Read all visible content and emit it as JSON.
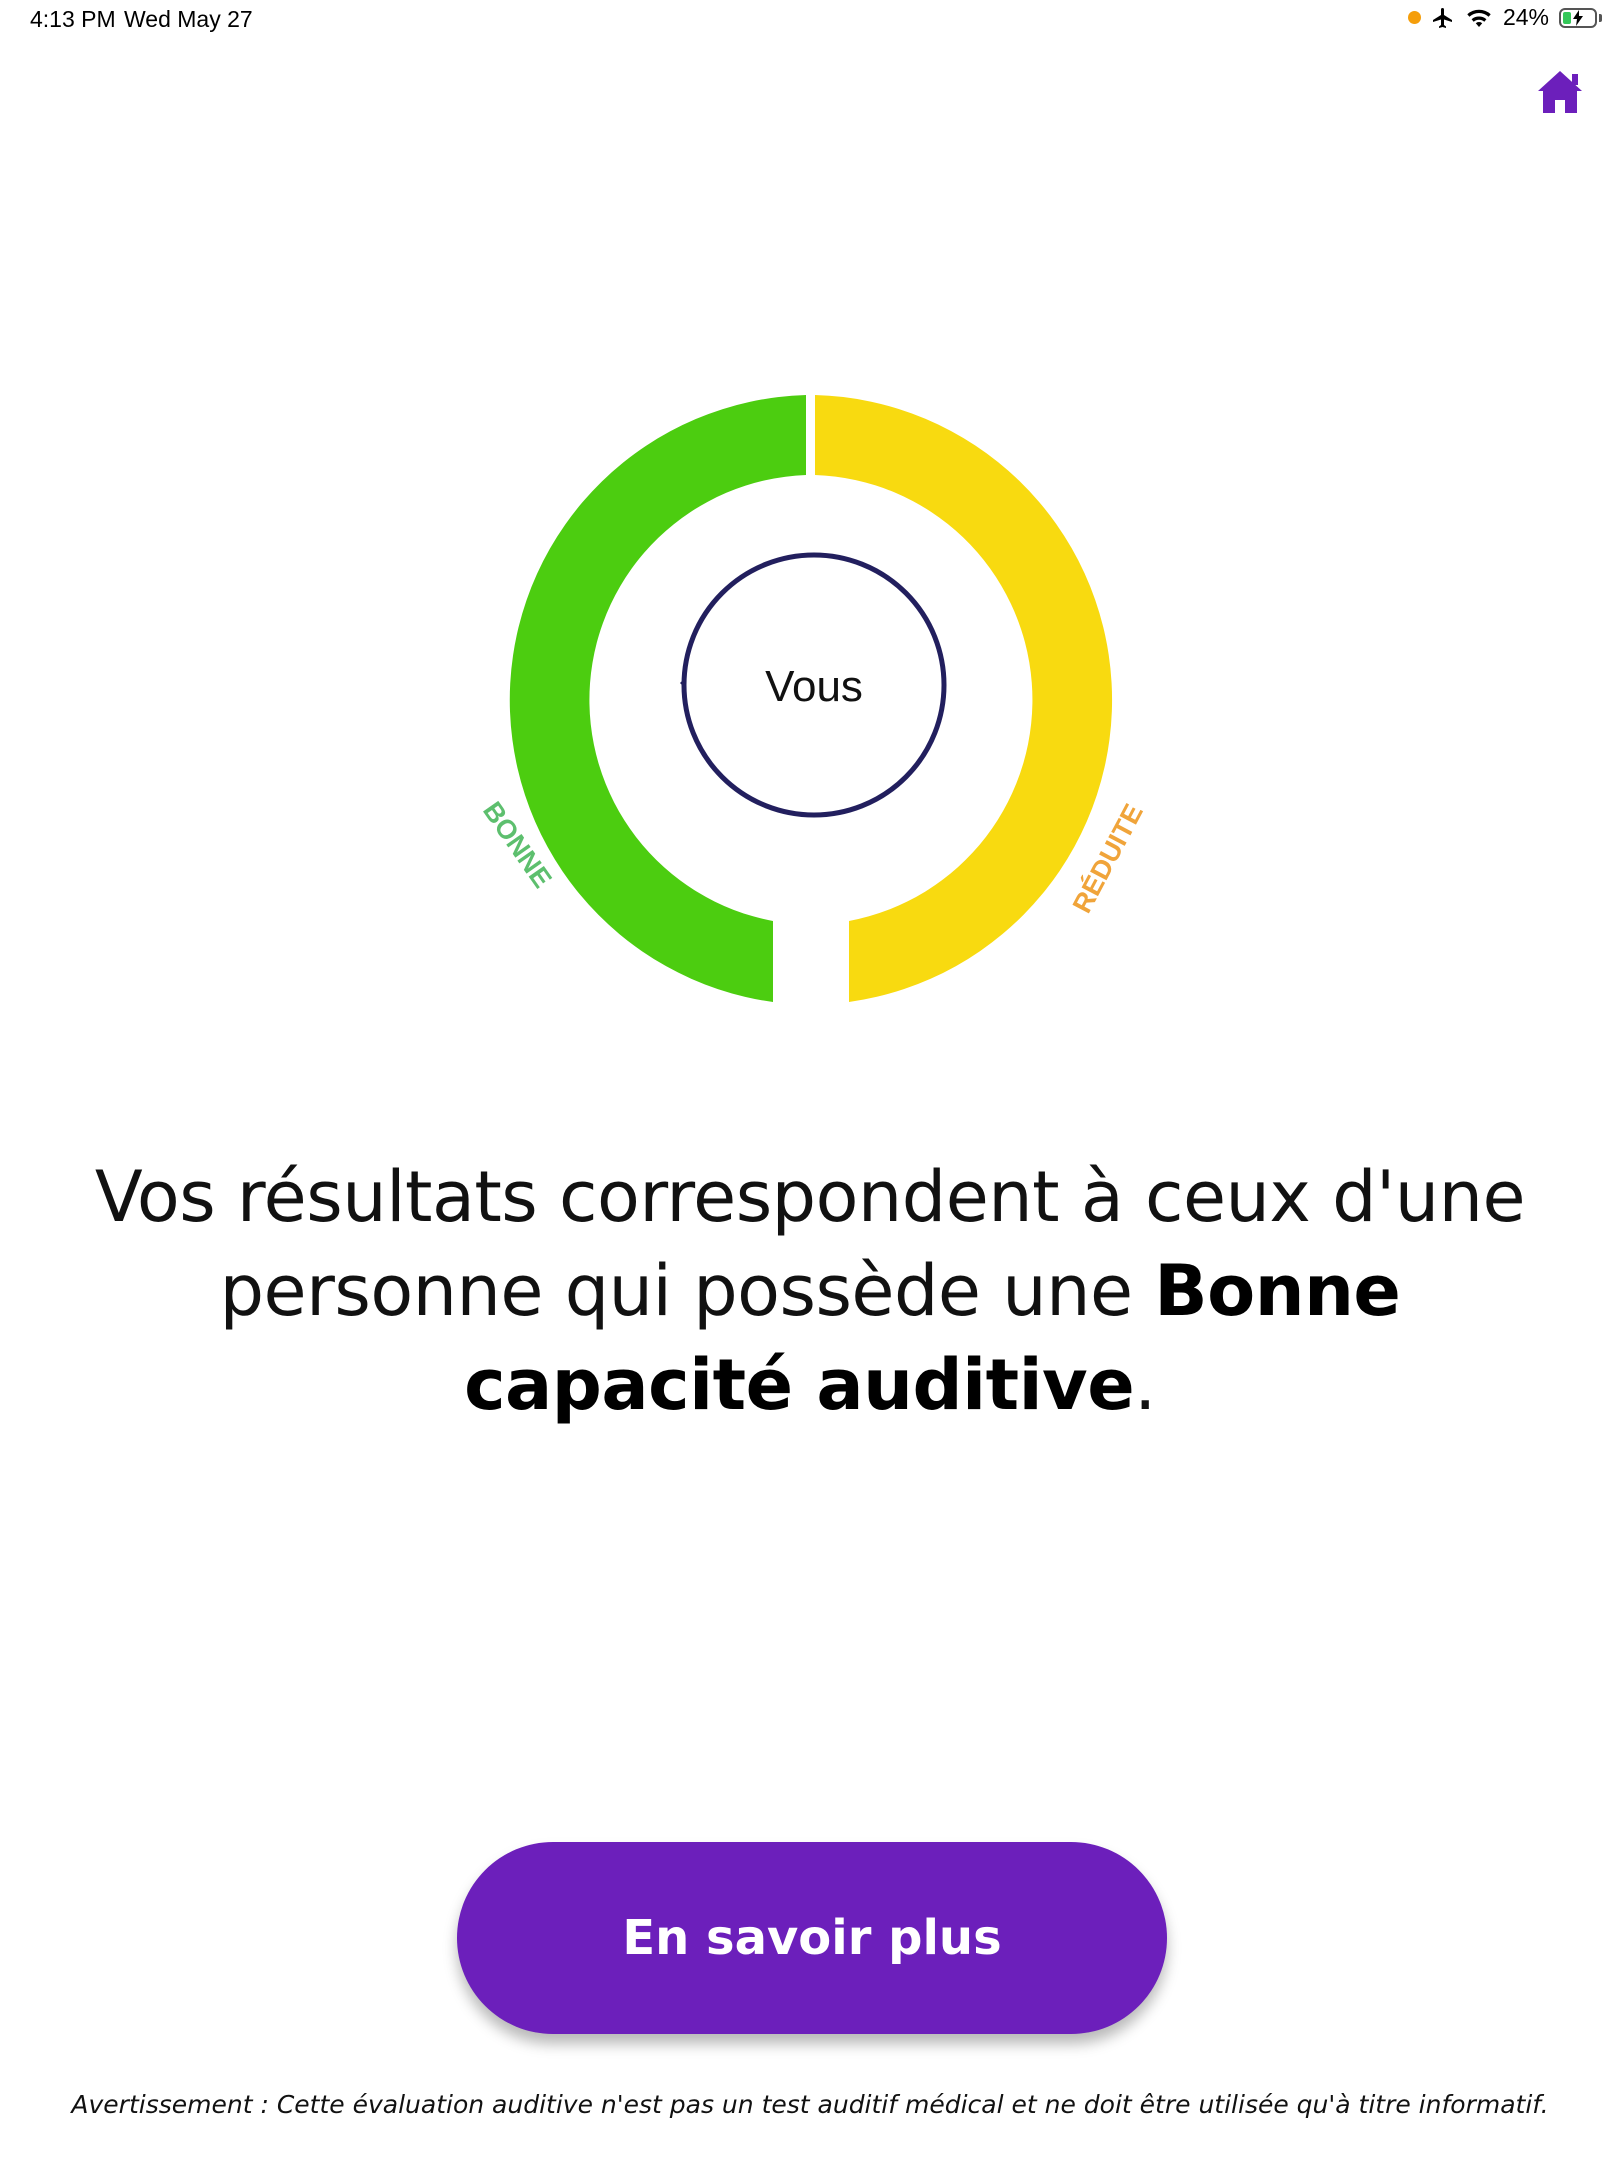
{
  "status_bar": {
    "time": "4:13 PM",
    "date": "Wed May 27",
    "battery": "24%",
    "icons": [
      "orange-dot",
      "airplane-icon",
      "wifi-icon",
      "battery-charging-icon"
    ]
  },
  "header": {
    "home_icon": "home-icon",
    "home_color": "#6c1fbb"
  },
  "gauge": {
    "center_label": "Vous",
    "left_label": "BONNE",
    "right_label": "RÉDUITE",
    "colors": {
      "good": "#4ccd10",
      "reduced": "#f8da10",
      "pointer": "#221f5e",
      "left_label": "#5dbf6e",
      "right_label": "#f0a43a"
    }
  },
  "result": {
    "prefix": "Vos résultats correspondent à ceux d'une personne qui possède une ",
    "highlight": "Bonne capacité auditive",
    "suffix": "."
  },
  "cta": {
    "label": "En savoir plus",
    "color": "#6c1fbb"
  },
  "disclaimer": "Avertissement : Cette évaluation auditive n'est pas un test auditif médical et ne doit être utilisée qu'à titre informatif."
}
